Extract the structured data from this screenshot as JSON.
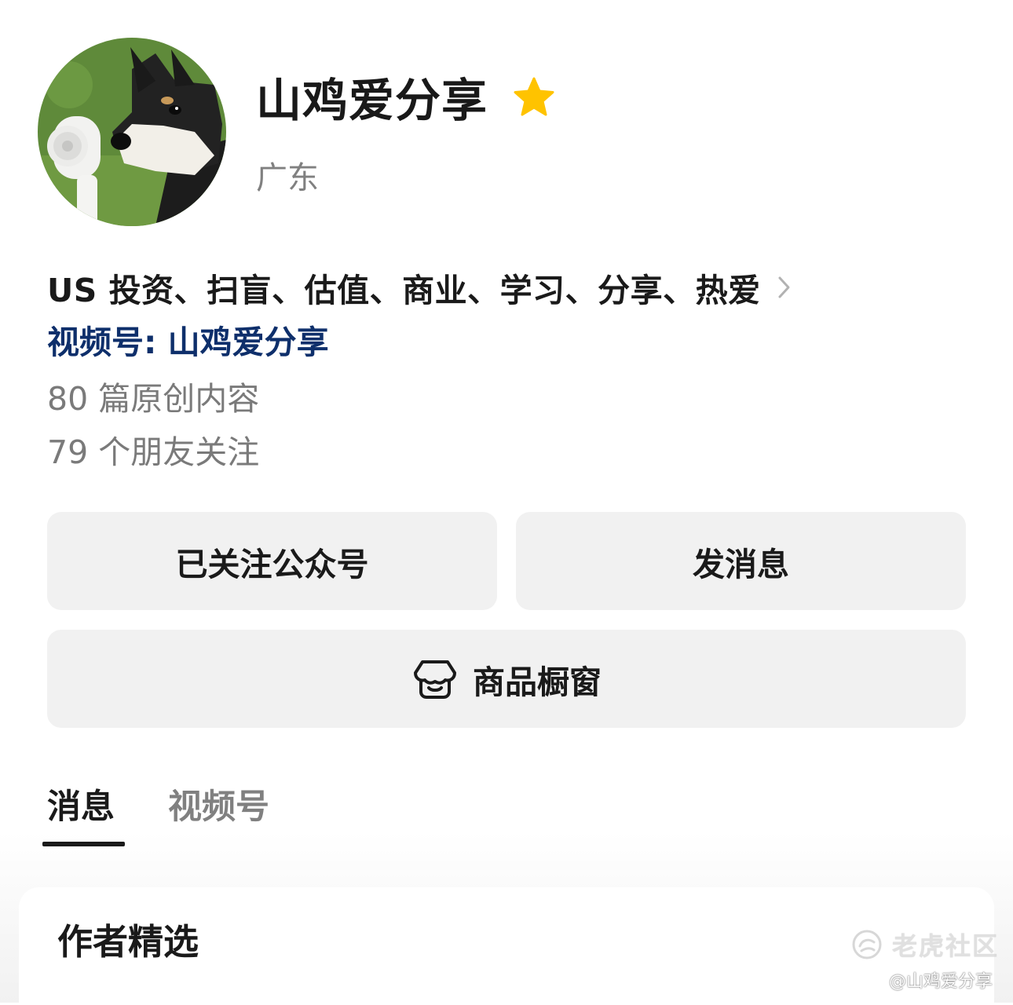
{
  "profile": {
    "name": "山鸡爱分享",
    "location": "广东",
    "bio": "US 投资、扫盲、估值、商业、学习、分享、热爱",
    "channel_link": "视频号: 山鸡爱分享",
    "articles_count": "80 篇原创内容",
    "friends_following": "79 个朋友关注",
    "avatar_icon": "shiba-dog-avatar",
    "star_icon": "star-icon",
    "star_color": "#FFC300"
  },
  "actions": {
    "follow_label": "已关注公众号",
    "message_label": "发消息",
    "shop_label": "商品橱窗",
    "shop_icon": "storefront-icon"
  },
  "tabs": [
    {
      "label": "消息",
      "active": true
    },
    {
      "label": "视频号",
      "active": false
    }
  ],
  "section": {
    "title": "作者精选"
  },
  "watermark": {
    "brand": "老虎社区",
    "handle": "@山鸡爱分享"
  }
}
